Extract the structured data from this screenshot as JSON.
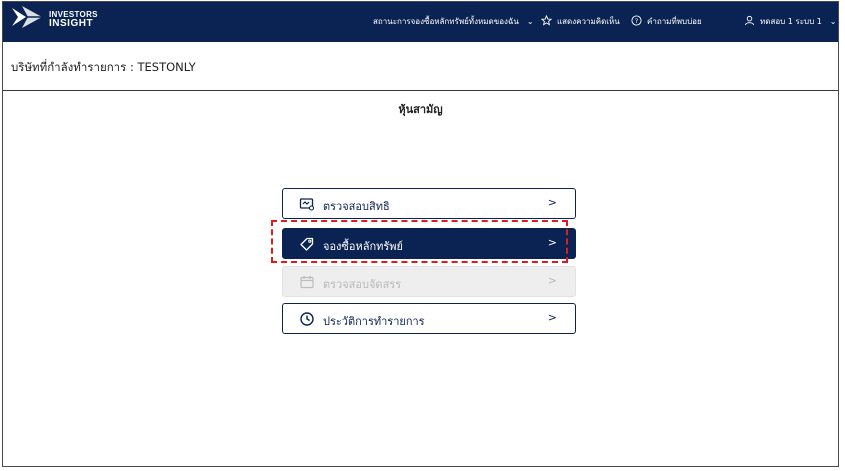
{
  "brand": {
    "line1": "INVESTORS",
    "line2": "INSIGHT"
  },
  "nav": {
    "status_menu": "สถานะการจองซื้อหลักทรัพย์ทั้งหมดของฉัน",
    "feedback": "แสดงความคิดเห็น",
    "faq": "คำถามที่พบบ่อย",
    "user": "ทดสอบ 1 ระบบ 1"
  },
  "company_line": "บริษัทที่กำลังทำรายการ : TESTONLY",
  "page_title": "หุ้นสามัญ",
  "menu": [
    {
      "label": "ตรวจสอบสิทธิ",
      "icon": "check-rights-icon",
      "state": "normal",
      "arrow": ">"
    },
    {
      "label": "จองซื้อหลักทรัพย์",
      "icon": "tag-icon",
      "state": "active",
      "arrow": ">"
    },
    {
      "label": "ตรวจสอบจัดสรร",
      "icon": "calendar-icon",
      "state": "disabled",
      "arrow": ">"
    },
    {
      "label": "ประวัติการทำรายการ",
      "icon": "clock-icon",
      "state": "normal",
      "arrow": ">"
    }
  ],
  "colors": {
    "navy": "#0b2352",
    "highlight": "#e01b1b",
    "disabled": "#eeeeee"
  }
}
